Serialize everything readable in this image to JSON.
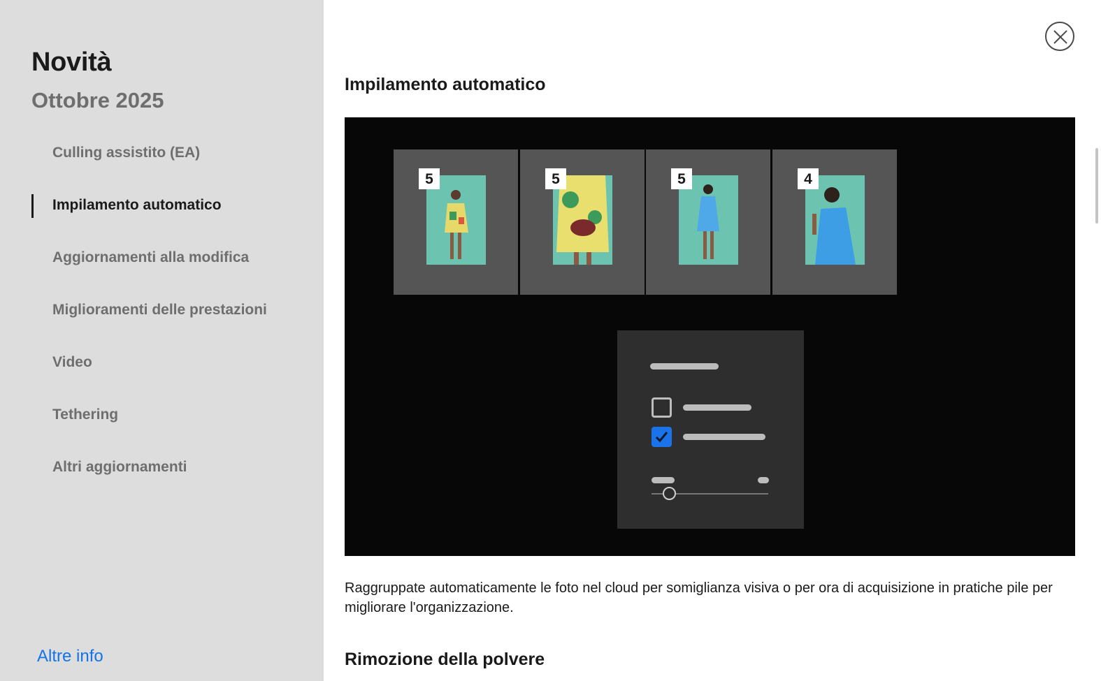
{
  "sidebar": {
    "title": "Novità",
    "subtitle": "Ottobre 2025",
    "items": [
      {
        "label": "Culling assistito (EA)",
        "active": false
      },
      {
        "label": "Impilamento automatico",
        "active": true
      },
      {
        "label": "Aggiornamenti alla modifica",
        "active": false
      },
      {
        "label": "Miglioramenti delle prestazioni",
        "active": false
      },
      {
        "label": "Video",
        "active": false
      },
      {
        "label": "Tethering",
        "active": false
      },
      {
        "label": "Altri aggiornamenti",
        "active": false
      }
    ],
    "more_info": "Altre info"
  },
  "main": {
    "close_icon": "close-icon",
    "sections": [
      {
        "title": "Impilamento automatico",
        "description": "Raggruppate automaticamente le foto nel cloud per somiglianza visiva o per ora di acquisizione in pratiche pile per migliorare l'organizzazione."
      },
      {
        "title": "Rimozione della polvere"
      }
    ],
    "illustration": {
      "stacks": [
        {
          "count": "5"
        },
        {
          "count": "5"
        },
        {
          "count": "5"
        },
        {
          "count": "4"
        }
      ],
      "panel_checkbox_states": [
        false,
        true
      ]
    }
  },
  "colors": {
    "sidebar_bg": "#dddddd",
    "accent_link": "#1473e6",
    "checkbox_checked": "#1a73e8",
    "photo_bg": "#6cc4b0"
  }
}
